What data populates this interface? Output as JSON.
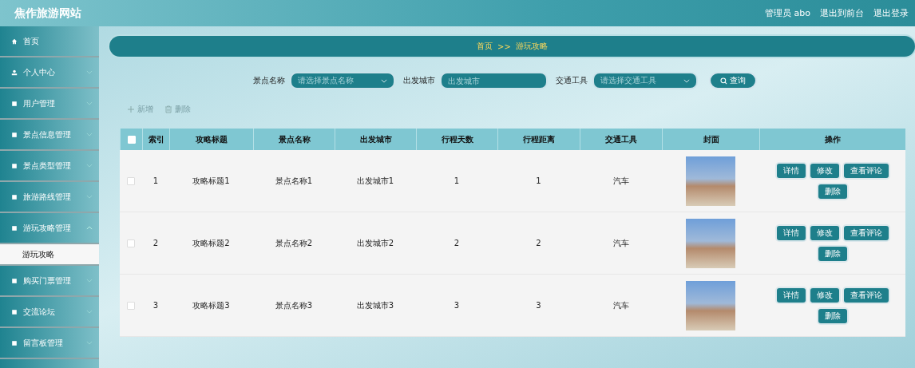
{
  "header": {
    "title": "焦作旅游网站",
    "user": "管理员 abo",
    "links": [
      "退出到前台",
      "退出登录"
    ]
  },
  "sidebar": {
    "items": [
      {
        "label": "首页",
        "selected": false
      },
      {
        "label": "个人中心",
        "expanded": false
      },
      {
        "label": "用户管理",
        "expanded": false
      },
      {
        "label": "景点信息管理",
        "expanded": false
      },
      {
        "label": "景点类型管理",
        "expanded": false
      },
      {
        "label": "旅游路线管理",
        "expanded": false
      },
      {
        "label": "游玩攻略管理",
        "expanded": true,
        "children": [
          {
            "label": "游玩攻略",
            "selected": true
          }
        ]
      },
      {
        "label": "购买门票管理",
        "expanded": false
      },
      {
        "label": "交流论坛",
        "expanded": false
      },
      {
        "label": "留言板管理",
        "expanded": false
      }
    ]
  },
  "breadcrumb": {
    "home": "首页",
    "separator": ">>",
    "current": "游玩攻略"
  },
  "search": {
    "fields": [
      {
        "kind": "select",
        "label": "景点名称",
        "placeholder": "请选择景点名称"
      },
      {
        "kind": "input",
        "label": "出发城市",
        "placeholder": "出发城市"
      },
      {
        "kind": "select",
        "label": "交通工具",
        "placeholder": "请选择交通工具"
      }
    ],
    "button": "查询"
  },
  "toolbar": {
    "add": "新增",
    "delete": "删除"
  },
  "table": {
    "all_checked": false,
    "columns": [
      "索引",
      "攻略标题",
      "景点名称",
      "出发城市",
      "行程天数",
      "行程距离",
      "交通工具",
      "封面",
      "操作"
    ],
    "rows": [
      {
        "checked": false,
        "cells": [
          "1",
          "攻略标题1",
          "景点名称1",
          "出发城市1",
          "1",
          "1",
          "汽车"
        ],
        "actions": [
          "详情",
          "修改",
          "查看评论",
          "删除"
        ]
      },
      {
        "checked": false,
        "cells": [
          "2",
          "攻略标题2",
          "景点名称2",
          "出发城市2",
          "2",
          "2",
          "汽车"
        ],
        "actions": [
          "详情",
          "修改",
          "查看评论",
          "删除"
        ]
      },
      {
        "checked": false,
        "cells": [
          "3",
          "攻略标题3",
          "景点名称3",
          "出发城市3",
          "3",
          "3",
          "汽车"
        ],
        "actions": [
          "详情",
          "修改",
          "查看评论",
          "删除"
        ]
      }
    ]
  }
}
